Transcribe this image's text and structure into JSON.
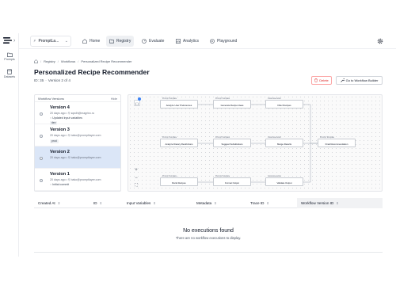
{
  "rail": {
    "items": [
      {
        "label": "Prompts",
        "icon": "folder-icon"
      },
      {
        "label": "Datasets",
        "icon": "database-icon"
      }
    ]
  },
  "navbar": {
    "project": "PromptLa...",
    "items": [
      {
        "label": "Home",
        "icon": "home-icon",
        "active": false
      },
      {
        "label": "Registry",
        "icon": "folder-icon",
        "active": true
      },
      {
        "label": "Evaluate",
        "icon": "gauge-icon",
        "active": false
      },
      {
        "label": "Analytics",
        "icon": "chart-icon",
        "active": false
      },
      {
        "label": "Playground",
        "icon": "play-icon",
        "active": false
      }
    ]
  },
  "breadcrumb": [
    "Registry",
    "Workflows",
    "Personalized Recipe Recommender"
  ],
  "page": {
    "title": "Personalized Recipe Recommender",
    "id_label": "ID: 35",
    "version_label": "Version 2 of 4",
    "delete_label": "Delete",
    "goto_label": "Go to Workflow Builder"
  },
  "versions": {
    "header": "Workflow Versions",
    "hide_label": "Hide",
    "items": [
      {
        "name": "Version 4",
        "meta": "20 days ago • ⚲ sqwlh@magrinc.ru",
        "note": "Updated input variables",
        "tag": "dev",
        "selected": false
      },
      {
        "name": "Version 3",
        "meta": "20 days ago • ⚲ bako@promptlayer.com",
        "note": "",
        "tag": "prod",
        "selected": false
      },
      {
        "name": "Version 2",
        "meta": "20 days ago • ⚲ bako@promptlayer.com",
        "note": "",
        "tag": "",
        "selected": true
      },
      {
        "name": "Version 1",
        "meta": "20 days ago • ⚲ bako@promptlayer.com",
        "note": "Initial commit",
        "tag": "",
        "selected": false
      }
    ]
  },
  "workflow": {
    "nodes": [
      {
        "type": "Prompt Template",
        "name": "Analyze User Preferences"
      },
      {
        "type": "Prompt Template",
        "name": "Generate Recipe Ideas"
      },
      {
        "type": "Code Execution",
        "name": "Filter Recipes"
      },
      {
        "type": "Prompt Template",
        "name": "Analyze Dietary Restrictions"
      },
      {
        "type": "Prompt Template",
        "name": "Suggest Substitutions"
      },
      {
        "type": "Code Execution",
        "name": "Merge Results"
      },
      {
        "type": "Prompt Template",
        "name": "Final Recommendation"
      },
      {
        "type": "Prompt Template",
        "name": "Rank Recipes"
      },
      {
        "type": "Prompt Template",
        "name": "Format Output"
      },
      {
        "type": "Code Execution",
        "name": "Validate Output"
      }
    ],
    "controls": {
      "expand": "{ }",
      "zoom_in": "+",
      "zoom_out": "−",
      "fit": "⛶"
    }
  },
  "executions": {
    "columns": [
      {
        "label": "Created At",
        "shaded": false
      },
      {
        "label": "ID",
        "shaded": false
      },
      {
        "label": "Input Variables",
        "shaded": false
      },
      {
        "label": "Metadata",
        "shaded": false
      },
      {
        "label": "Trace ID",
        "shaded": false
      },
      {
        "label": "Workflow Version ID",
        "shaded": true
      }
    ],
    "empty_title": "No executions found",
    "empty_subtitle": "There are no workflow executions to display."
  },
  "colors": {
    "accent": "#3b82f6",
    "selected_row": "#dbe6f7",
    "danger": "#dc2626",
    "nav_active": "#eef0f3"
  }
}
